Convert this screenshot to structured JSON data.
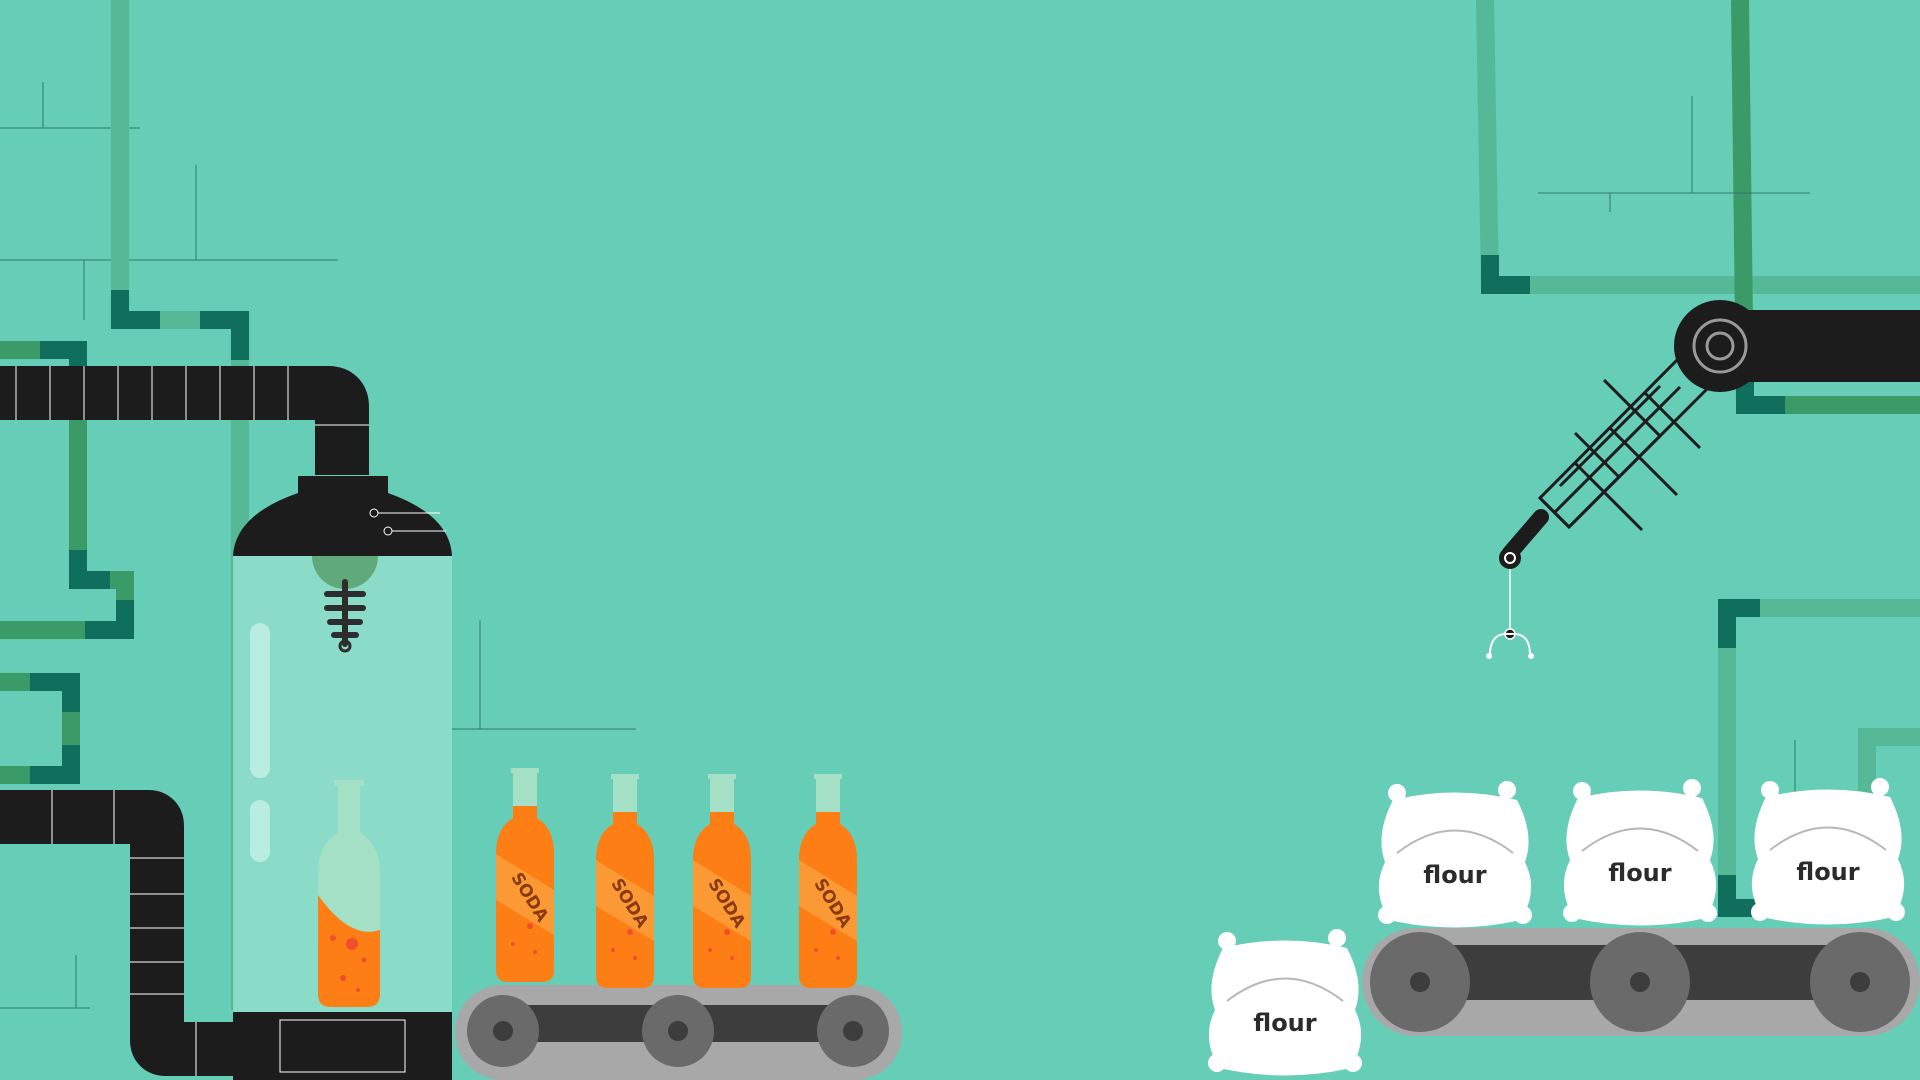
{
  "scene": {
    "colors": {
      "background": "#66CDB7",
      "pipe_light": "#55B896",
      "pipe_mid": "#3A9A68",
      "pipe_dark": "#106E5C",
      "machine_black": "#1C1C1C",
      "soda_orange": "#FD7E14",
      "bottle_neck": "#A3E0C6",
      "flour_bag": "#FFFFFF",
      "conveyor_gray": "#A8A8A8",
      "wheel_gray": "#6A6A6A"
    },
    "soda_bottles": [
      {
        "label": "SODA"
      },
      {
        "label": "SODA"
      },
      {
        "label": "SODA"
      },
      {
        "label": "SODA"
      }
    ],
    "flour_bags": [
      {
        "label": "flour"
      },
      {
        "label": "flour"
      },
      {
        "label": "flour"
      },
      {
        "label": "flour"
      }
    ]
  }
}
